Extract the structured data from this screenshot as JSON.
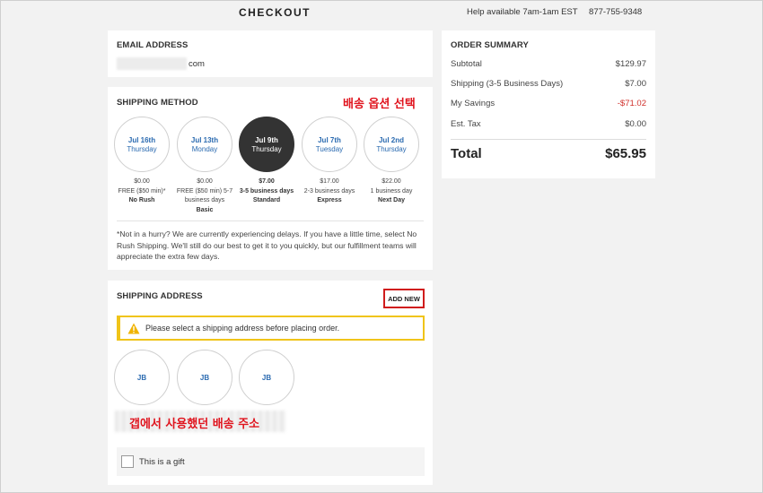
{
  "header": {
    "title": "CHECKOUT",
    "help_text": "Help available 7am-1am EST",
    "phone": "877-755-9348"
  },
  "email": {
    "title": "EMAIL ADDRESS",
    "domain": "com"
  },
  "shipping_method": {
    "title": "SHIPPING METHOD",
    "annotation": "배송 옵션 선택",
    "selected_index": 2,
    "options": [
      {
        "date": "Jul 16th",
        "day": "Thursday",
        "price": "$0.00",
        "time": "FREE ($50 min)*",
        "name": "No Rush"
      },
      {
        "date": "Jul 13th",
        "day": "Monday",
        "price": "$0.00",
        "time": "FREE ($50 min) 5-7 business days",
        "name": "Basic"
      },
      {
        "date": "Jul 9th",
        "day": "Thursday",
        "price": "$7.00",
        "time": "3-5 business days",
        "name": "Standard"
      },
      {
        "date": "Jul 7th",
        "day": "Tuesday",
        "price": "$17.00",
        "time": "2-3 business days",
        "name": "Express"
      },
      {
        "date": "Jul 2nd",
        "day": "Thursday",
        "price": "$22.00",
        "time": "1 business day",
        "name": "Next Day"
      }
    ],
    "note": "*Not in a hurry? We are currently experiencing delays. If you have a little time, select No Rush Shipping. We'll still do our best to get it to you quickly, but our fulfillment teams will appreciate the extra few days."
  },
  "shipping_address": {
    "title": "SHIPPING ADDRESS",
    "add_new_label": "ADD NEW",
    "alert": "Please select a shipping address before placing order.",
    "addresses": [
      "JB",
      "JB",
      "JB"
    ],
    "annotation": "갭에서 사용했던 배송 주소",
    "gift_label": "This is a gift"
  },
  "order_summary": {
    "title": "ORDER SUMMARY",
    "rows": [
      {
        "label": "Subtotal",
        "value": "$129.97"
      },
      {
        "label": "Shipping (3-5 Business Days)",
        "value": "$7.00"
      },
      {
        "label": "My Savings",
        "value": "-$71.02"
      },
      {
        "label": "Est. Tax",
        "value": "$0.00"
      }
    ],
    "total_label": "Total",
    "total_value": "$65.95"
  },
  "colors": {
    "accent_blue": "#2a6ab0",
    "selected_dark": "#333333",
    "annotation_red": "#e0141e",
    "alert_yellow": "#f0c419",
    "savings_red": "#d0302b"
  }
}
